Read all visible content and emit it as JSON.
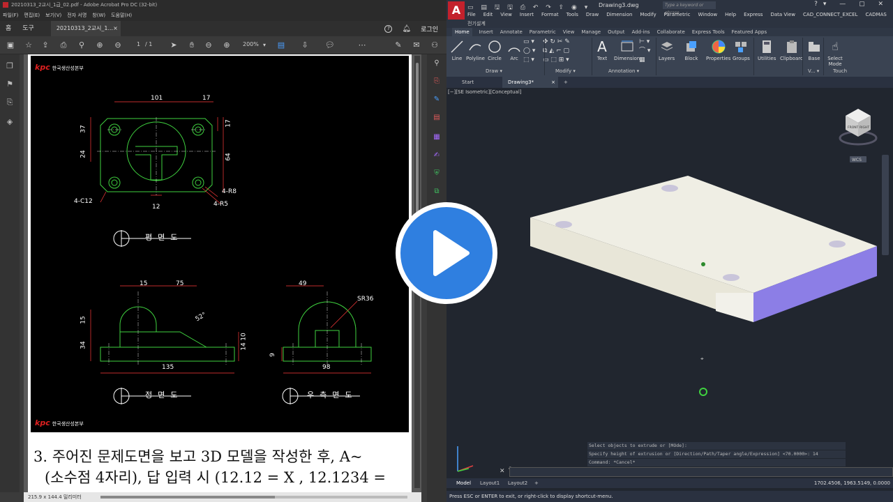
{
  "acrobat": {
    "window_title": "20210313_2교시_1급_02.pdf - Adobe Acrobat Pro DC (32-bit)",
    "menu": [
      "파일(F)",
      "편집(E)",
      "보기(V)",
      "전자 서명",
      "창(W)",
      "도움말(H)"
    ],
    "tabs": {
      "home": "홈",
      "tools": "도구",
      "document": "20210313_2교시_1...",
      "close": "×"
    },
    "login_label": "로그인",
    "toolbar": {
      "page_current": "1",
      "page_total": "/ 1",
      "zoom": "200%"
    },
    "status_dim": "215.9 x 144.4 밀리미터",
    "document": {
      "header_logo": "kpc",
      "header_org": "한국생산성본부",
      "footer_logo": "kpc",
      "footer_org": "한국생산성본부",
      "dims_top": {
        "d101": "101",
        "d17a": "17",
        "d37": "37",
        "d17b": "17",
        "d24": "24",
        "d64": "64",
        "r8": "4-R8",
        "c12": "4-C12",
        "r5": "4-R5",
        "d12": "12"
      },
      "dims_front": {
        "d15": "15",
        "d75": "75",
        "d15v": "15",
        "d34": "34",
        "d52": "52°",
        "d14": "14",
        "d10": "10",
        "d135": "135"
      },
      "dims_side": {
        "d49": "49",
        "sr36": "SR36",
        "d9": "9",
        "d98": "98"
      },
      "plan_label": "평면도",
      "front_label": "정면도",
      "right_label": "우측면도",
      "question_line1": "3. 주어진 문제도면을 보고 3D 모델을 작성한 후, A~",
      "question_line2": "(소수점 4자리), 답 입력 시 (12.12 = X , 12.1234 ="
    }
  },
  "autocad": {
    "app_letter": "A",
    "doc_title": "Drawing3.dwg",
    "search_placeholder": "Type a keyword or phrase",
    "menubar": [
      "File",
      "Edit",
      "View",
      "Insert",
      "Format",
      "Tools",
      "Draw",
      "Dimension",
      "Modify",
      "Parametric",
      "Window",
      "Help",
      "Express",
      "Data View",
      "CAD_CONNECT_EXCEL",
      "CADMAS"
    ],
    "menubar2": "전기설계",
    "ribbon_tabs": [
      "Home",
      "Insert",
      "Annotate",
      "Parametric",
      "View",
      "Manage",
      "Output",
      "Add-ins",
      "Collaborate",
      "Express Tools",
      "Featured Apps"
    ],
    "ribbon": {
      "line": "Line",
      "polyline": "Polyline",
      "circle": "Circle",
      "arc": "Arc",
      "text": "Text",
      "dimension": "Dimension",
      "layers": "Layers",
      "block": "Block",
      "properties": "Properties",
      "groups": "Groups",
      "utilities": "Utilities",
      "clipboard": "Clipboard",
      "base": "Base",
      "select_mode": "Select Mode",
      "touch": "Touch",
      "panel_draw": "Draw ▾",
      "panel_modify": "Modify ▾",
      "panel_annotation": "Annotation ▾",
      "panel_view": "V... ▾"
    },
    "file_tabs": {
      "start": "Start",
      "drawing": "Drawing3*",
      "close": "×",
      "add": "+"
    },
    "viewport_label": "[−][SE Isometric][Conceptual]",
    "viewcube": {
      "front": "FRONT",
      "right": "RIGHT",
      "wcs": "WCS"
    },
    "command_history": [
      "Select objects to extrude or [MOde]:",
      "Specify height of extrusion or [Direction/Path/Taper angle/Expression] <70.0000>: 14",
      "Command: *Cancel*"
    ],
    "command_prompt": "",
    "layout_tabs": [
      "Model",
      "Layout1",
      "Layout2",
      "+"
    ],
    "coords": "1702.4506, 1963.5149, 0.0000",
    "status_msg": "Press ESC or ENTER to exit, or right-click to display shortcut-menu."
  }
}
